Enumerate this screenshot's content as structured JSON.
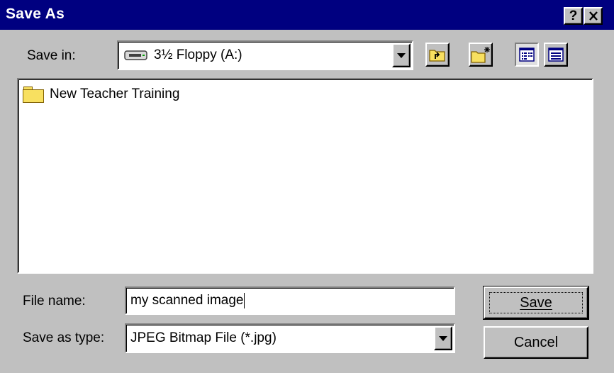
{
  "window": {
    "title": "Save As",
    "help_label": "?",
    "close_label": "✕"
  },
  "save_in": {
    "label": "Save in:",
    "value": "3½ Floppy (A:)",
    "drive_icon": "floppy-drive-icon"
  },
  "toolbar": {
    "up_one_level_icon": "up-one-level-icon",
    "new_folder_icon": "new-folder-icon",
    "list_view_icon": "list-view-icon",
    "details_view_icon": "details-view-icon"
  },
  "file_list": {
    "items": [
      {
        "name": "New Teacher Training",
        "icon": "folder-icon"
      }
    ]
  },
  "file_name": {
    "label": "File name:",
    "value": "my scanned image"
  },
  "save_as_type": {
    "label": "Save as type:",
    "value": "JPEG Bitmap File (*.jpg)"
  },
  "buttons": {
    "save_label": "Save",
    "cancel_label": "Cancel"
  },
  "colors": {
    "title_bar": "#000080",
    "face": "#c0c0c0",
    "folder_yellow": "#f8e060"
  }
}
